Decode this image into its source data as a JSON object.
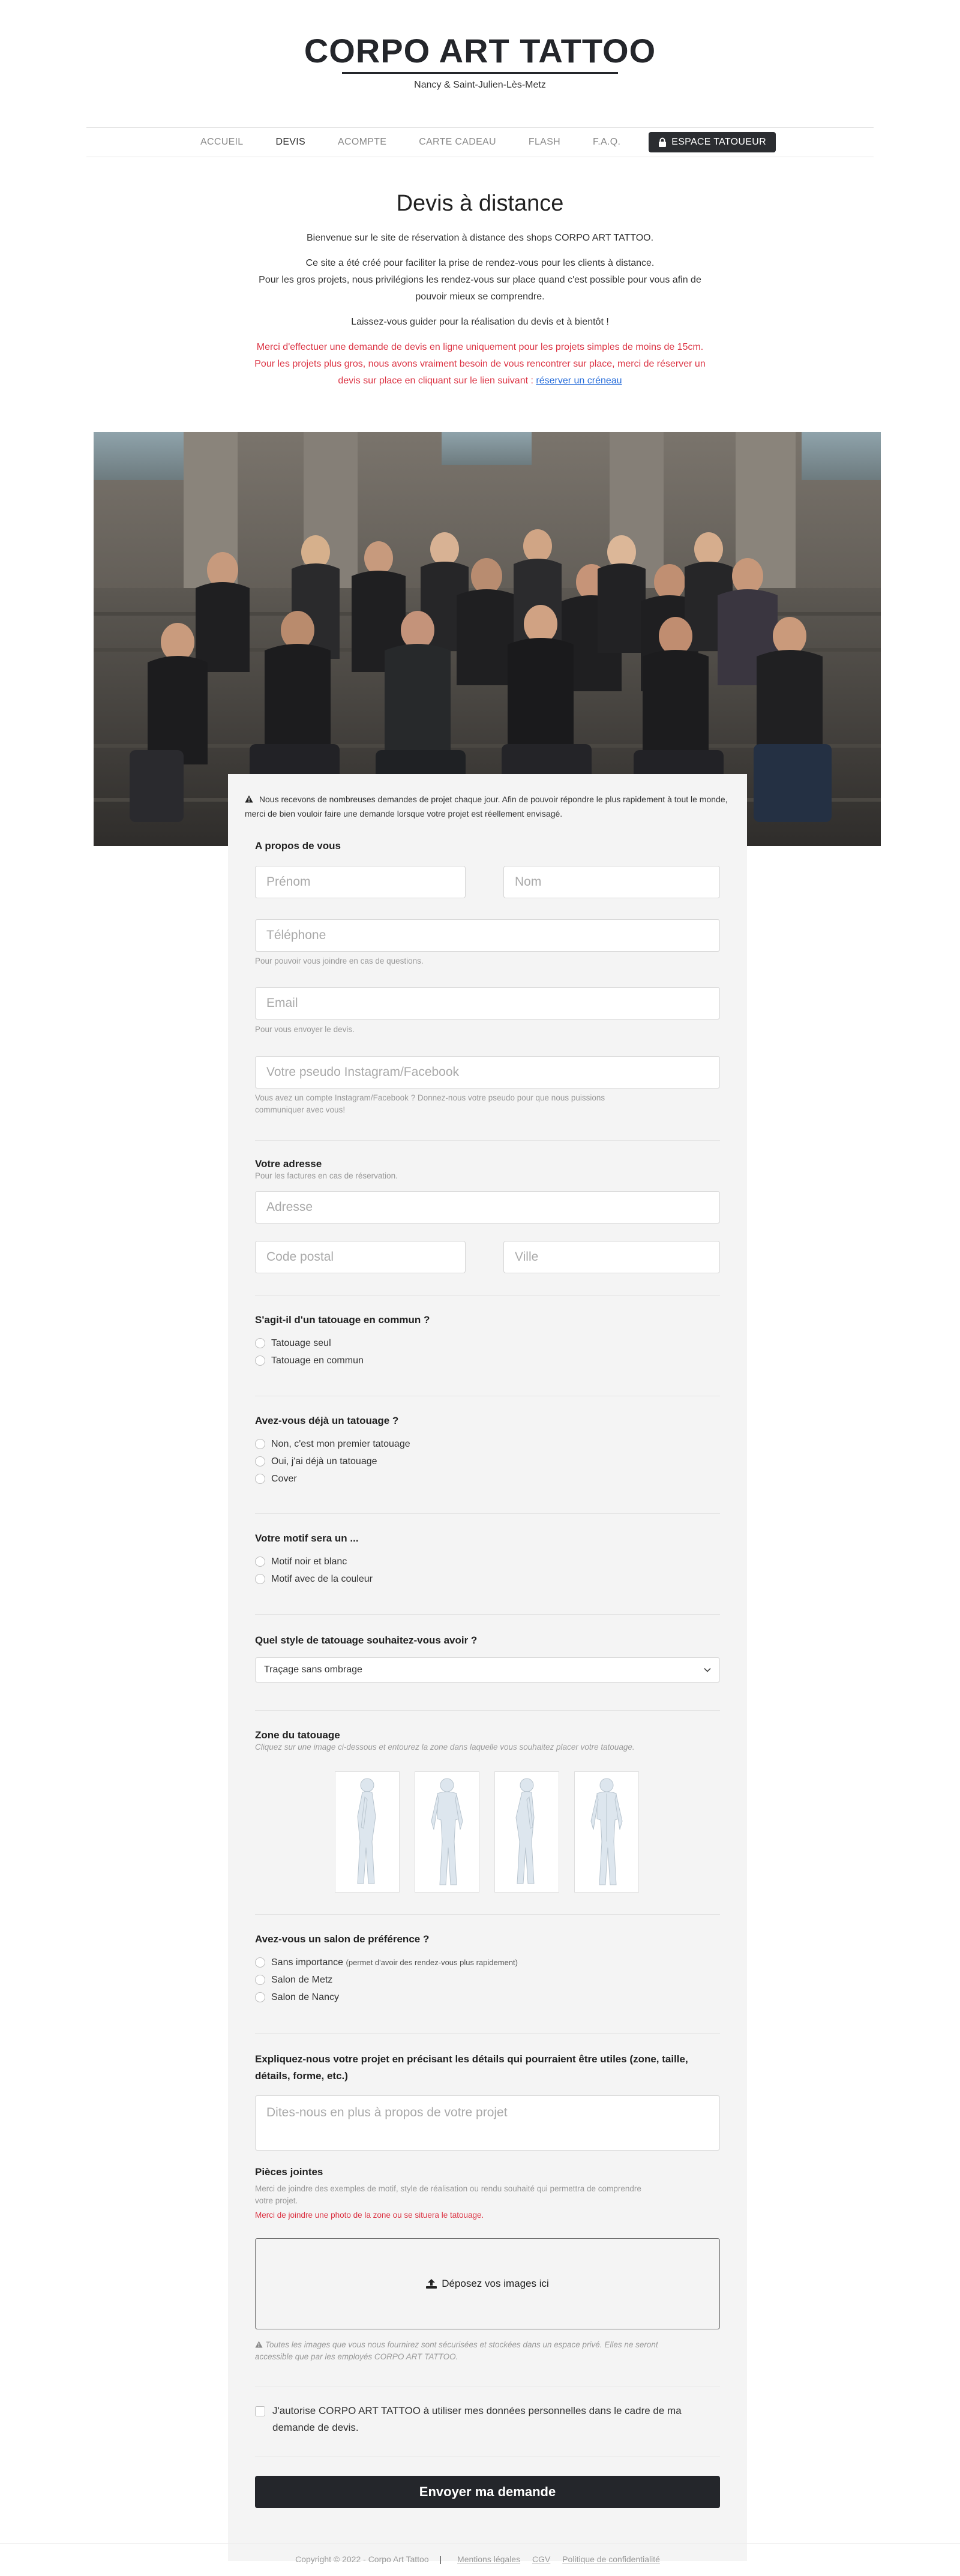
{
  "header": {
    "logo": "CORPO ART TATTOO",
    "subtitle": "Nancy & Saint-Julien-Lès-Metz"
  },
  "nav": {
    "items": [
      "ACCUEIL",
      "DEVIS",
      "ACOMPTE",
      "CARTE CADEAU",
      "FLASH",
      "F.A.Q."
    ],
    "active": "DEVIS",
    "espace": "ESPACE TATOUEUR"
  },
  "intro": {
    "title": "Devis à distance",
    "p1": "Bienvenue sur le site de réservation à distance des shops CORPO ART TATTOO.",
    "p2a": "Ce site a été créé pour faciliter la prise de rendez-vous pour les clients à distance.",
    "p2b": "Pour les gros projets, nous privilégions les rendez-vous sur place quand c'est possible pour vous afin de",
    "p2c": "pouvoir mieux se comprendre.",
    "p3": "Laissez-vous guider pour la réalisation du devis et à bientôt !",
    "warn1": "Merci d'effectuer une demande de devis en ligne uniquement pour les projets simples de moins de 15cm.",
    "warn2": "Pour les projets plus gros, nous avons vraiment besoin de vous rencontrer sur place, merci de réserver un",
    "warn3": "devis sur place en cliquant sur le lien suivant : ",
    "warn_link": "réserver un créneau"
  },
  "form": {
    "notice": "Nous recevons de nombreuses demandes de projet chaque jour. Afin de pouvoir répondre le plus rapidement à tout le monde, merci de bien vouloir faire une demande lorsque votre projet est réellement envisagé.",
    "about": {
      "title": "A propos de vous",
      "prenom": "Prénom",
      "nom": "Nom",
      "telephone": "Téléphone",
      "telephone_hint": "Pour pouvoir vous joindre en cas de questions.",
      "email": "Email",
      "email_hint": "Pour vous envoyer le devis.",
      "pseudo": "Votre pseudo Instagram/Facebook",
      "pseudo_hint1": "Vous avez un compte Instagram/Facebook ? Donnez-nous votre pseudo pour que nous puissions",
      "pseudo_hint2": "communiquer avec vous!"
    },
    "address": {
      "title": "Votre adresse",
      "hint": "Pour les factures en cas de réservation.",
      "adresse": "Adresse",
      "code_postal": "Code postal",
      "ville": "Ville"
    },
    "q_commun": {
      "title": "S'agit-il d'un tatouage en commun ?",
      "options": [
        "Tatouage seul",
        "Tatouage en commun"
      ]
    },
    "q_deja": {
      "title": "Avez-vous déjà un tatouage ?",
      "options": [
        "Non, c'est mon premier tatouage",
        "Oui, j'ai déjà un tatouage",
        "Cover"
      ]
    },
    "q_motif": {
      "title": "Votre motif sera un ...",
      "options": [
        "Motif noir et blanc",
        "Motif avec de la couleur"
      ]
    },
    "q_style": {
      "title": "Quel style de tatouage souhaitez-vous avoir ?",
      "selected": "Traçage sans ombrage"
    },
    "zone": {
      "title": "Zone du tatouage",
      "hint": "Cliquez sur une image ci-dessous et entourez la zone dans laquelle vous souhaitez placer votre tatouage."
    },
    "q_salon": {
      "title": "Avez-vous un salon de préférence ?",
      "opt1": "Sans importance",
      "opt1_small": "(permet d'avoir des rendez-vous plus rapidement)",
      "opt2": "Salon de Metz",
      "opt3": "Salon de Nancy"
    },
    "projet": {
      "title1": "Expliquez-nous votre projet en précisant les détails qui pourraient être utiles (zone, taille,",
      "title2": "détails, forme, etc.)",
      "placeholder": "Dites-nous en plus à propos de votre projet"
    },
    "pieces": {
      "title": "Pièces jointes",
      "hint1": "Merci de joindre des exemples de motif, style de réalisation ou rendu souhaité qui permettra de comprendre",
      "hint2": "votre projet.",
      "hint_red": "Merci de joindre une photo de la zone ou se situera le tatouage.",
      "dropzone": "Déposez vos images ici",
      "secure1": "Toutes les images que vous nous fournirez sont sécurisées et stockées dans un espace privé. Elles ne seront",
      "secure2": "accessible que par les employés CORPO ART TATTOO."
    },
    "consent1": "J'autorise CORPO ART TATTOO à utiliser mes données personnelles dans le cadre de ma",
    "consent2": "demande de devis.",
    "submit": "Envoyer ma demande"
  },
  "footer": {
    "copyright": "Copyright © 2022 - Corpo Art Tattoo",
    "links": [
      "Mentions légales",
      "CGV",
      "Politique de confidentialité"
    ]
  }
}
